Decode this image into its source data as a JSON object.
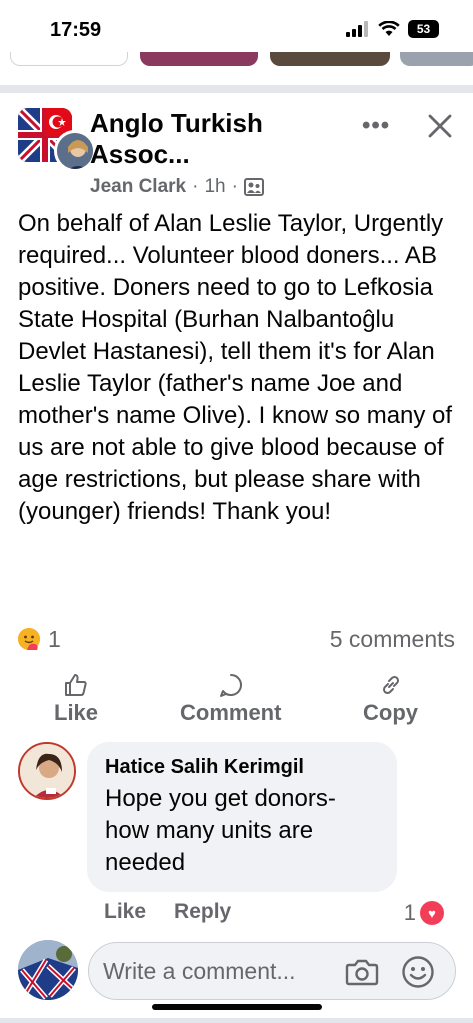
{
  "status_bar": {
    "time": "17:59",
    "battery": "53"
  },
  "post": {
    "group_name": "Anglo Turkish Assoc...",
    "author": "Jean Clark",
    "time": "1h",
    "separator": "·",
    "more_label": "•••",
    "text": "On behalf of Alan Leslie Taylor, Urgently required... Volunteer blood doners... AB positive. Doners need to go to Lefkosia State Hospital (Burhan Nalbantoĝlu Devlet Hastanesi), tell them it's for Alan Leslie Taylor (father's name Joe and mother's name Olive). I know so many of us are not able to give blood because of age restrictions, but please share with (younger) friends! Thank you!",
    "reaction_count": "1",
    "comment_count": "5 comments"
  },
  "actions": {
    "like": "Like",
    "comment": "Comment",
    "copy": "Copy"
  },
  "comment": {
    "author": "Hatice Salih Kerimgil",
    "text": "Hope you get donors- how many units are needed",
    "like": "Like",
    "reply": "Reply",
    "reactions": "1"
  },
  "composer": {
    "placeholder": "Write a comment..."
  },
  "colors": {
    "secondary_text": "#65676b",
    "bubble": "#f0f2f5",
    "heart": "#f33e58"
  }
}
